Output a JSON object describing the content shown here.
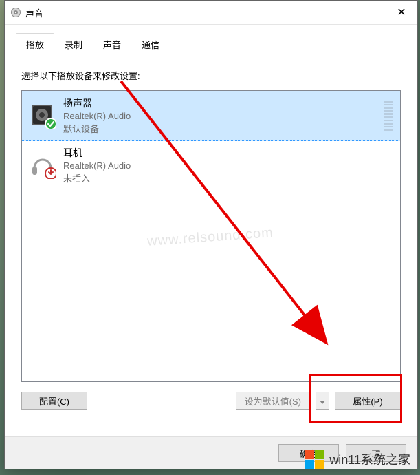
{
  "window": {
    "title": "声音",
    "close_glyph": "✕"
  },
  "tabs": {
    "t0": "播放",
    "t1": "录制",
    "t2": "声音",
    "t3": "通信"
  },
  "instruction": "选择以下播放设备来修改设置:",
  "devices": [
    {
      "name": "扬声器",
      "driver": "Realtek(R) Audio",
      "status": "默认设备",
      "icon": "speaker",
      "badge": "check",
      "selected": true,
      "meter": true
    },
    {
      "name": "耳机",
      "driver": "Realtek(R) Audio",
      "status": "未插入",
      "icon": "headphones",
      "badge": "down",
      "selected": false,
      "meter": false
    }
  ],
  "buttons": {
    "configure": "配置(C)",
    "set_default": "设为默认值(S)",
    "properties": "属性(P)",
    "ok": "确定",
    "cancel": "取"
  },
  "watermark": "www.relsound.com",
  "brand": "win11系统之家"
}
